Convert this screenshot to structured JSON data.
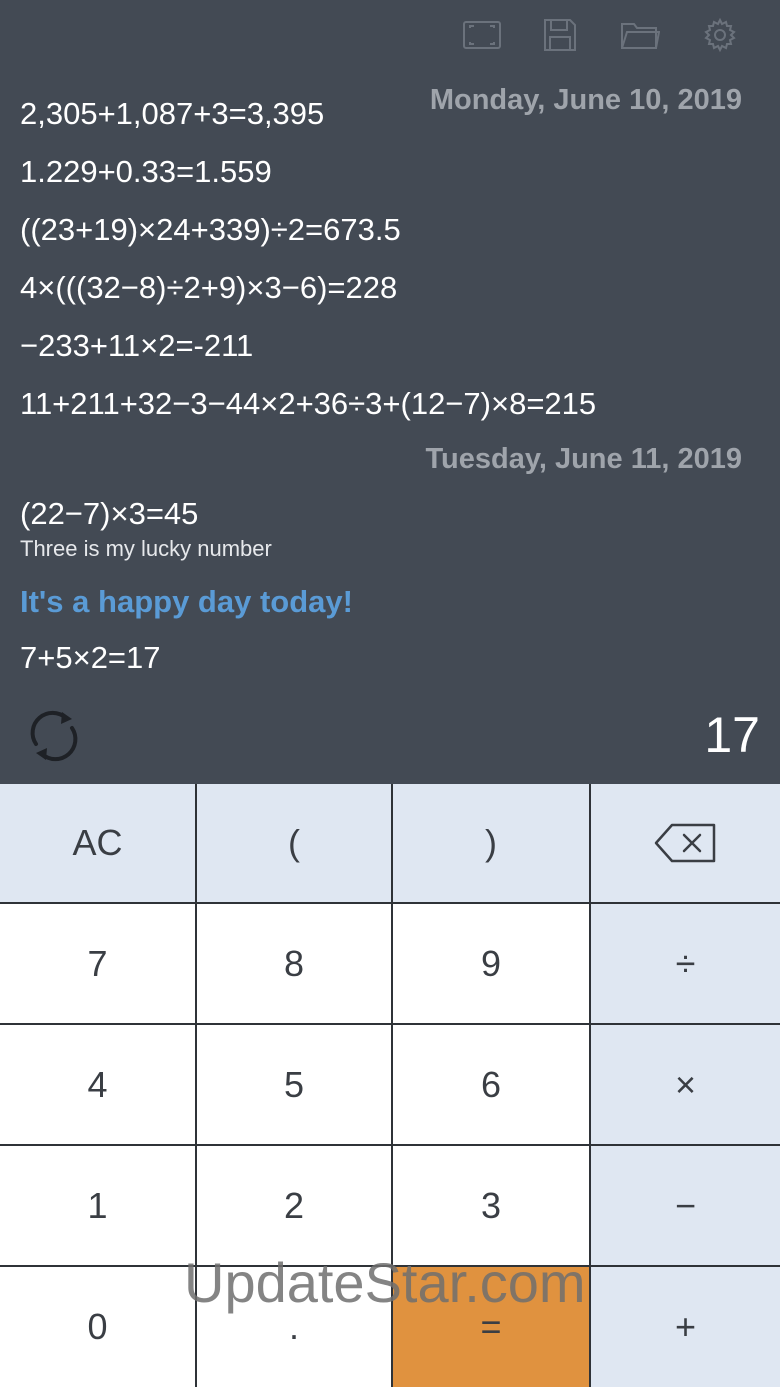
{
  "toolbar": {
    "icons": [
      "fullscreen-icon",
      "save-icon",
      "folder-icon",
      "gear-icon"
    ]
  },
  "tape": {
    "sections": [
      {
        "date": "Monday, June 10, 2019",
        "lines": [
          "2,305+1,087+3=3,395",
          "1.229+0.33=1.559",
          "((23+19)×24+339)÷2=673.5",
          "4×(((32−8)÷2+9)×3−6)=228",
          "−233+11×2=-211",
          "11+211+32−3−44×2+36÷3+(12−7)×8=215"
        ]
      },
      {
        "date": "Tuesday, June 11, 2019",
        "calc": "(22−7)×3=45",
        "note": "Three is my lucky number",
        "headline": "It's a happy day today!",
        "last": "7+5×2=17"
      }
    ]
  },
  "result": "17",
  "keypad": {
    "row1": [
      "AC",
      "(",
      ")",
      "backspace-icon"
    ],
    "row2": [
      "7",
      "8",
      "9",
      "÷"
    ],
    "row3": [
      "4",
      "5",
      "6",
      "×"
    ],
    "row4": [
      "1",
      "2",
      "3",
      "−"
    ],
    "row5": [
      "0",
      ".",
      "=",
      "+"
    ]
  },
  "watermark": "UpdateStar.com",
  "colors": {
    "background": "#434a54",
    "date": "#9fa4ab",
    "headline": "#5a9bd6",
    "key_light": "#dfe7f2",
    "key_white": "#ffffff",
    "equals": "#e0923f"
  }
}
